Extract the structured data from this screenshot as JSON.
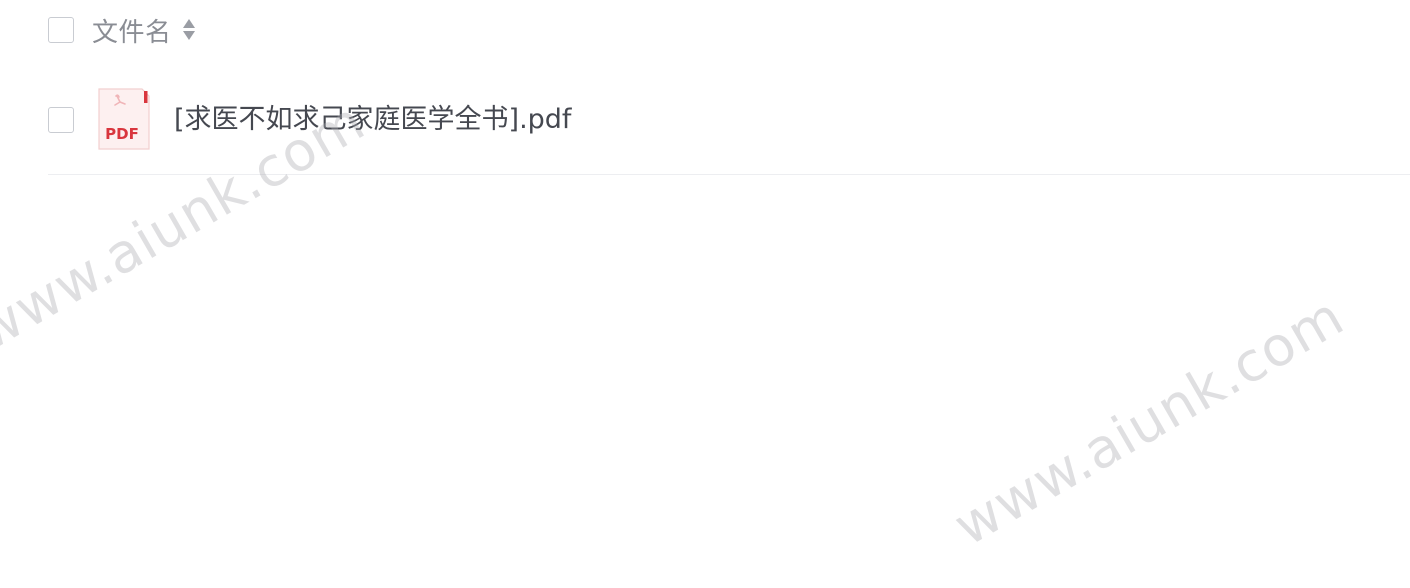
{
  "file_list": {
    "header": {
      "column_title": "文件名"
    },
    "files": [
      {
        "name": "[求医不如求己家庭医学全书].pdf",
        "type_label": "PDF"
      }
    ]
  },
  "watermark": {
    "text": "www.aiunk.com"
  },
  "colors": {
    "pdf_red": "#d9363e",
    "text_main": "#454850",
    "text_header": "#8a8d94"
  },
  "icons": {
    "sort": "sort-updown-icon",
    "file": "pdf-file-icon"
  }
}
